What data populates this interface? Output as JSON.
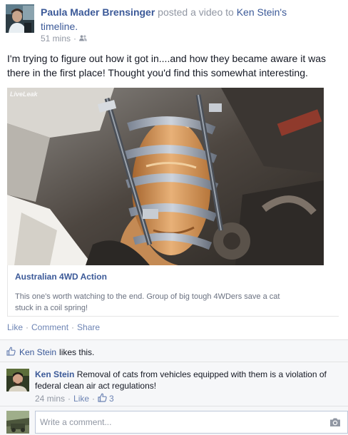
{
  "header": {
    "author": "Paula Mader Brensinger",
    "action": "posted a video to",
    "target": "Ken Stein's",
    "target_suffix": "timeline.",
    "time": "51 mins",
    "audience_icon": "friends-icon"
  },
  "post": {
    "text": "I'm trying to figure out how it got in....and how they became aware it was there in the first place! Thought you'd find this somewhat interesting."
  },
  "video": {
    "watermark": "LiveLeak",
    "link_title": "Australian 4WD Action",
    "link_description": "This one's worth watching to the end. Group of big tough 4WDers save a cat stuck in a coil spring!"
  },
  "actions": {
    "like": "Like",
    "comment": "Comment",
    "share": "Share"
  },
  "ufi": {
    "likes_name": "Ken Stein",
    "likes_text": "likes this.",
    "comment": {
      "author": "Ken Stein",
      "text": "Removal of cats from vehicles equipped with them is a violation of federal clean air act regulations!",
      "time": "24 mins",
      "like": "Like",
      "like_count": "3"
    },
    "write_placeholder": "Write a comment..."
  },
  "colors": {
    "link": "#3b5998",
    "action_link": "#6d84b4",
    "muted": "#9197a3",
    "ufi_bg": "#f6f7f9"
  }
}
